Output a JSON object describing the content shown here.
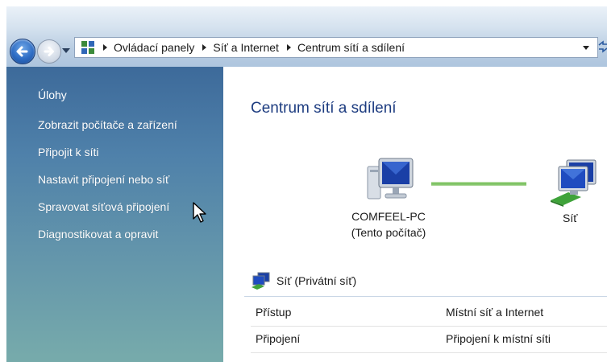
{
  "address_bar": {
    "breadcrumbs": [
      "Ovládací panely",
      "Síť a Internet",
      "Centrum sítí a sdílení"
    ]
  },
  "task_pane": {
    "heading": "Úlohy",
    "items": [
      "Zobrazit počítače a zařízení",
      "Připojit k síti",
      "Nastavit připojení nebo síť",
      "Spravovat síťová připojení",
      "Diagnostikovat a opravit"
    ]
  },
  "main": {
    "title": "Centrum sítí a sdílení",
    "computer": {
      "name": "COMFEEL-PC",
      "sub": "(Tento počítač)"
    },
    "network_label": "Síť",
    "network_header": "Síť (Privátní síť)",
    "properties": [
      {
        "key": "Přístup",
        "value": "Místní síť a Internet"
      },
      {
        "key": "Připojení",
        "value": "Připojení k místní síti"
      }
    ]
  },
  "colors": {
    "title": "#1d3c80",
    "task_pane_top": "#3d6a9a",
    "task_pane_bottom": "#77abab",
    "connection_line": "#6cba4f"
  },
  "icons": [
    "back-arrow-icon",
    "forward-arrow-icon",
    "control-panel-icon",
    "computer-icon",
    "network-icon",
    "refresh-icon",
    "mouse-cursor"
  ]
}
